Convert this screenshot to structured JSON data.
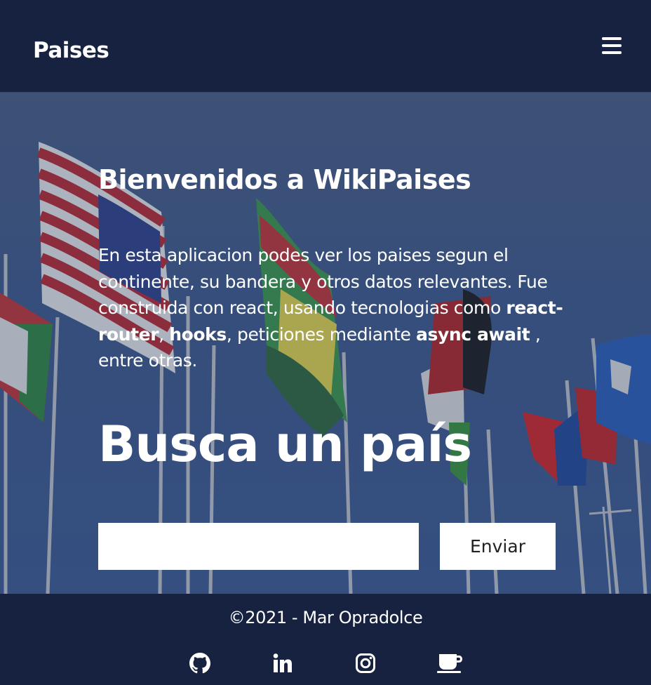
{
  "nav": {
    "brand": "Paises",
    "menu_icon": "hamburger-menu-icon"
  },
  "hero": {
    "welcome_title": "Bienvenidos a WikiPaises",
    "intro": {
      "part1": "En esta aplicacion podes ver los paises segun el continente, su bandera y otros datos relevantes. Fue construida con react, usando tecnologias como ",
      "bold1": "react-router",
      "sep1": ", ",
      "bold2": "hooks",
      "part2": ", peticiones mediante ",
      "bold3": "async await",
      "part3": " , entre otras."
    },
    "search_title": "Busca un país",
    "search_input": {
      "value": "",
      "placeholder": ""
    },
    "submit_label": "Enviar",
    "background_image": "flags-on-poles"
  },
  "footer": {
    "copyright": "©2021 - Mar Opradolce",
    "social_icons": [
      "github-icon",
      "linkedin-icon",
      "instagram-icon",
      "coffee-icon"
    ]
  }
}
